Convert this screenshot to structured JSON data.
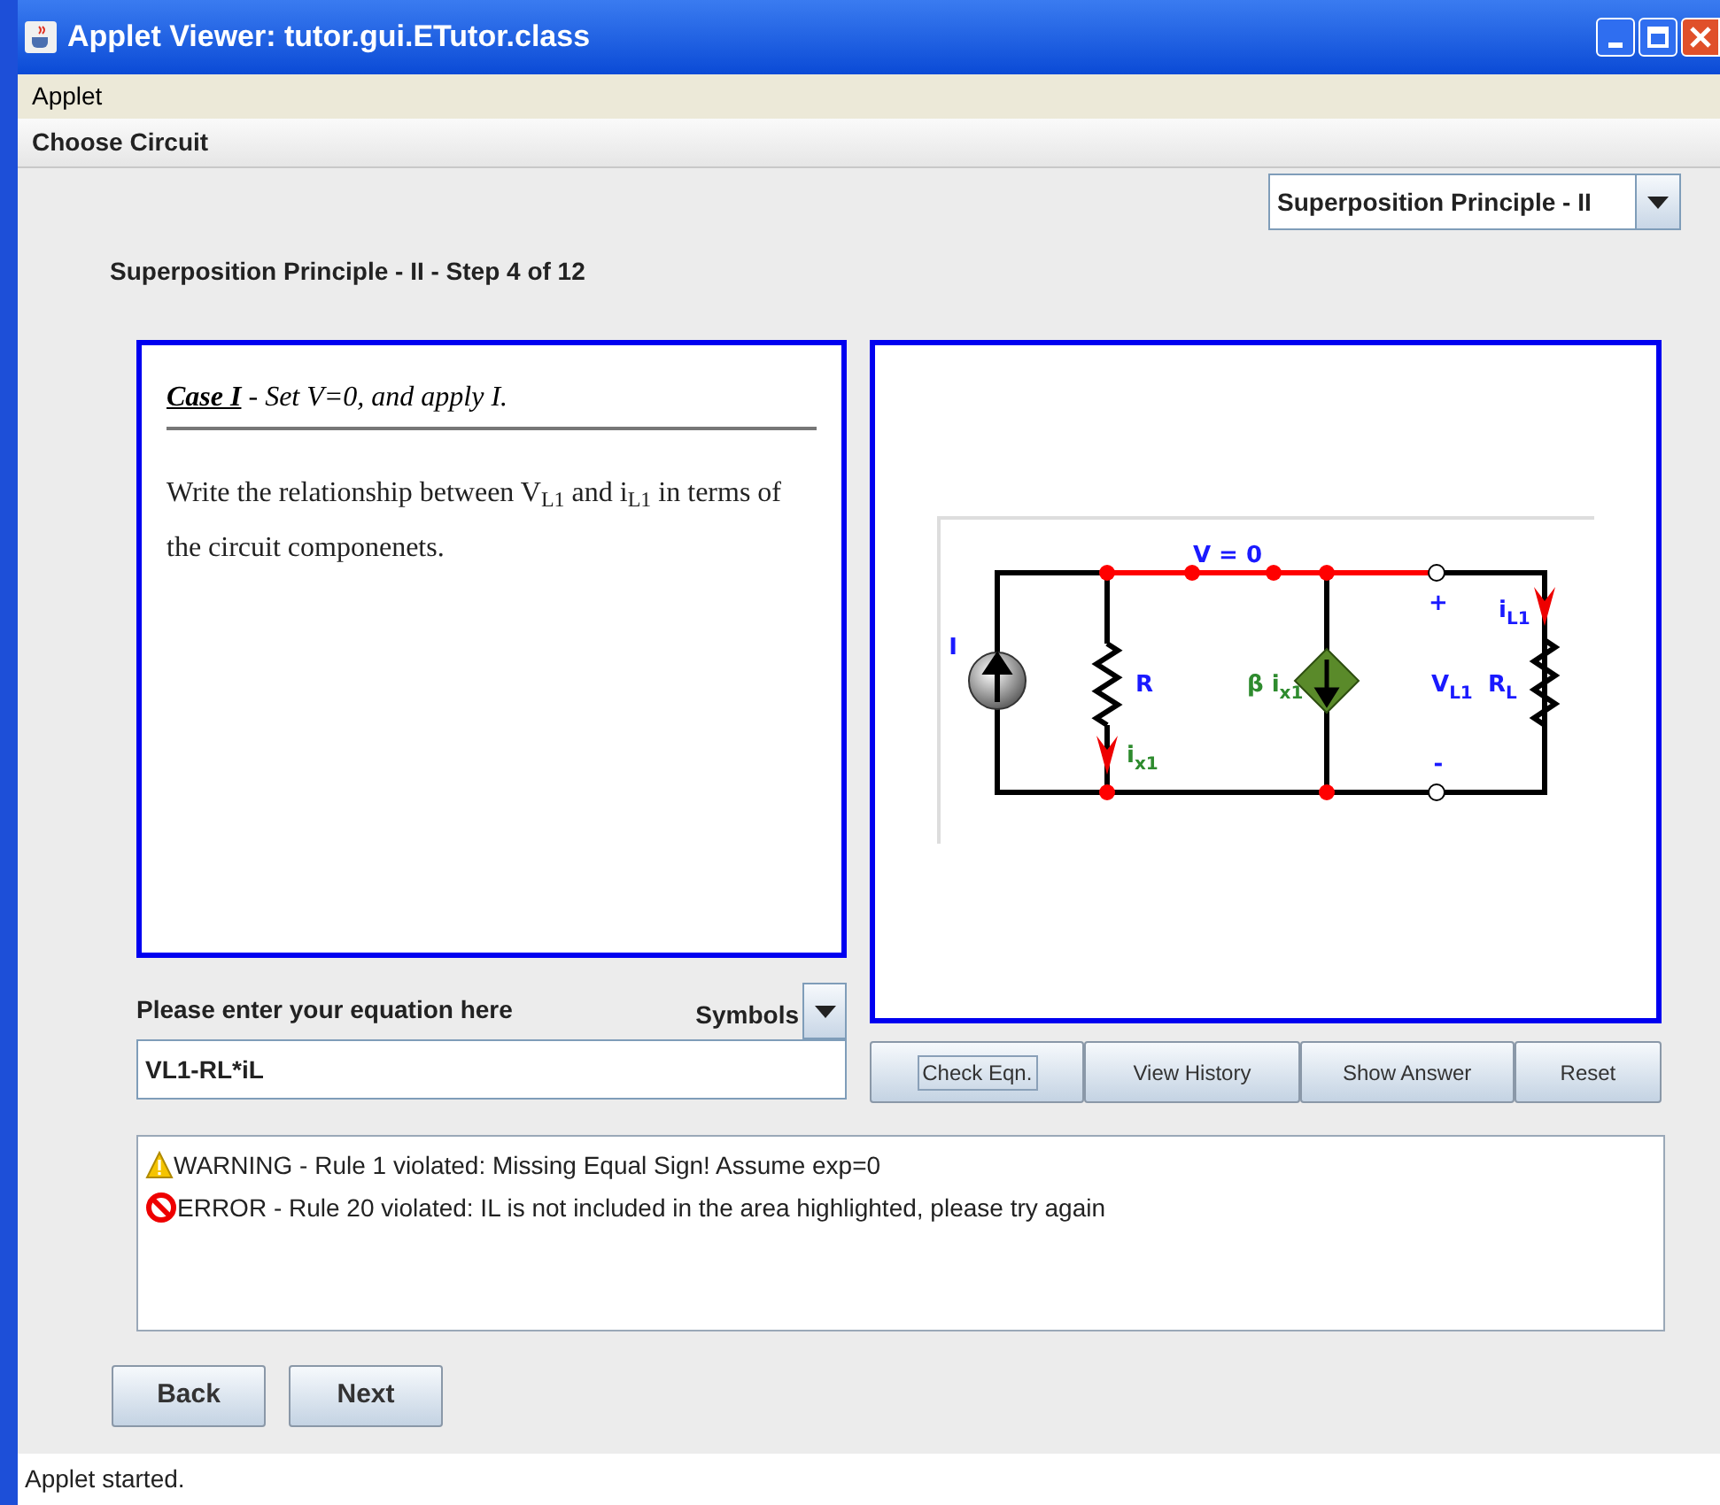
{
  "window": {
    "title": "Applet Viewer: tutor.gui.ETutor.class"
  },
  "menu": [
    "Applet"
  ],
  "section_bar": "Choose Circuit",
  "circuit_select": {
    "value": "Superposition Principle - II"
  },
  "step_title": "Superposition Principle - II - Step 4 of 12",
  "instruction": {
    "heading": "**Case I** - Set V=0, and apply I.",
    "body": "Write the relationship between V$_{L1}$ and i$_{L1}$ in terms of the circuit componenets."
  },
  "circuit_labels": [
    {
      "text": "V = 0",
      "color": "#1a1aff"
    },
    {
      "text": "I",
      "color": "#1a1aff"
    },
    {
      "text": "R",
      "color": "#1a1aff"
    },
    {
      "text": "β i",
      "sub": "x1",
      "color": "#2e8b2e"
    },
    {
      "text": "+",
      "color": "#1a1aff"
    },
    {
      "text": "i",
      "sub": "L1",
      "color": "#1a1aff"
    },
    {
      "text": "V",
      "sub": "L1",
      "color": "#1a1aff"
    },
    {
      "text": "R",
      "sub": "L",
      "color": "#1a1aff"
    },
    {
      "text": "i",
      "sub": "x1",
      "color": "#2e8b2e"
    },
    {
      "text": "-",
      "color": "#1a1aff"
    }
  ],
  "equation": {
    "label": "Please enter your equation here",
    "symbols_button": "Symbols",
    "value": "VL1-RL*iL"
  },
  "actions": [
    {
      "label": "Check Eqn.",
      "focused": true
    },
    {
      "label": "View History",
      "focused": false
    },
    {
      "label": "Show Answer",
      "focused": false
    },
    {
      "label": "Reset",
      "focused": false
    }
  ],
  "messages": [
    {
      "kind": "warning",
      "text": "WARNING - Rule 1 violated: Missing Equal Sign! Assume exp=0"
    },
    {
      "kind": "error",
      "text": "ERROR - Rule 20 violated: IL is not included in the area highlighted, please try again"
    }
  ],
  "nav_buttons": [
    "Back",
    "Next"
  ],
  "status_bar": "Applet started."
}
